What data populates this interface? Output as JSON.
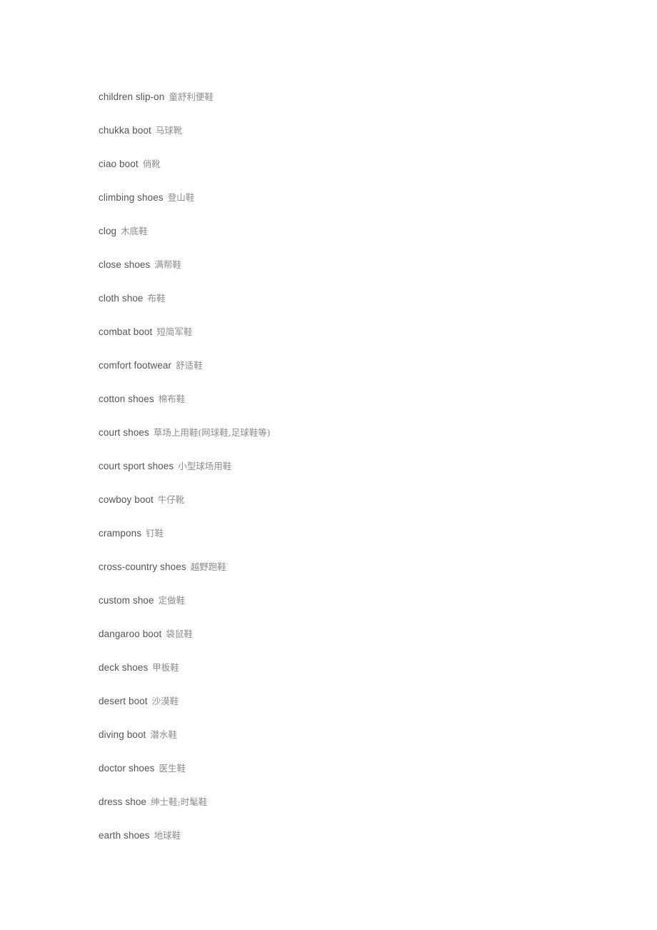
{
  "document": {
    "type": "bilingual-glossary",
    "subject": "footwear terminology",
    "language_pair": "English-Chinese"
  },
  "glossary": {
    "entries": [
      {
        "term": "children slip-on",
        "gloss": "童舒利便鞋"
      },
      {
        "term": "chukka boot",
        "gloss": "马球靴"
      },
      {
        "term": "ciao boot",
        "gloss": "俏靴"
      },
      {
        "term": "climbing shoes",
        "gloss": "登山鞋"
      },
      {
        "term": "clog",
        "gloss": "木底鞋"
      },
      {
        "term": "close shoes",
        "gloss": "满帮鞋"
      },
      {
        "term": "cloth shoe",
        "gloss": "布鞋"
      },
      {
        "term": "combat boot",
        "gloss": "短简军鞋"
      },
      {
        "term": "comfort footwear",
        "gloss": "舒适鞋"
      },
      {
        "term": "cotton shoes",
        "gloss": "棉布鞋"
      },
      {
        "term": "court shoes",
        "gloss": "草场上用鞋(网球鞋,足球鞋等)"
      },
      {
        "term": "court sport shoes",
        "gloss": "小型球场用鞋"
      },
      {
        "term": "cowboy boot",
        "gloss": "牛仔靴"
      },
      {
        "term": "crampons",
        "gloss": "钉鞋"
      },
      {
        "term": "cross-country shoes",
        "gloss": "越野跑鞋"
      },
      {
        "term": "custom shoe",
        "gloss": "定做鞋"
      },
      {
        "term": "dangaroo boot",
        "gloss": "袋鼠鞋"
      },
      {
        "term": "deck shoes",
        "gloss": "甲板鞋"
      },
      {
        "term": "desert boot",
        "gloss": "沙漠鞋"
      },
      {
        "term": "diving boot",
        "gloss": "潜水鞋"
      },
      {
        "term": "doctor shoes",
        "gloss": "医生鞋"
      },
      {
        "term": "dress shoe",
        "gloss": "绅士鞋;时髦鞋"
      },
      {
        "term": "earth shoes",
        "gloss": "地球鞋"
      }
    ]
  },
  "colors": {
    "page_background": "#ffffff",
    "term_text": "#555555",
    "gloss_text": "#8c8c8c"
  }
}
